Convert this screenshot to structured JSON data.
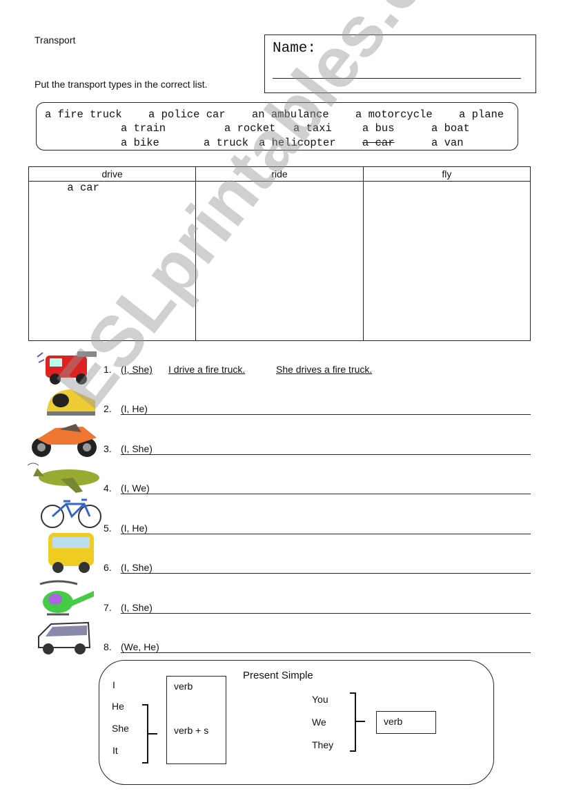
{
  "header": {
    "title": "Transport",
    "instruction": "Put the transport types in the correct list.",
    "name_label": "Name:"
  },
  "word_bank": {
    "rows": [
      [
        "a fire truck",
        "a police car",
        "an ambulance",
        "a motorcycle",
        "a plane"
      ],
      [
        "a train",
        "a rocket",
        "a taxi",
        "a bus",
        "a boat"
      ],
      [
        "a bike",
        "a truck",
        "a helicopter",
        "a car",
        "a van"
      ]
    ],
    "crossed_out": "a car"
  },
  "sort_table": {
    "columns": [
      "drive",
      "ride",
      "fly"
    ],
    "entries": {
      "drive": "a car",
      "ride": "",
      "fly": ""
    }
  },
  "exercises": [
    {
      "num": "1.",
      "prompt": "(I, She)",
      "answer": "I drive a fire truck.",
      "answer2": "She drives a fire truck.",
      "picture": "fire-truck"
    },
    {
      "num": "2.",
      "prompt": "(I, He)",
      "picture": "train"
    },
    {
      "num": "3.",
      "prompt": "(I, She)",
      "picture": "motorcycle"
    },
    {
      "num": "4.",
      "prompt": "(I, We)",
      "picture": "plane"
    },
    {
      "num": "5.",
      "prompt": "(I, He)",
      "picture": "bike"
    },
    {
      "num": "6.",
      "prompt": "(I, She)",
      "picture": "bus"
    },
    {
      "num": "7.",
      "prompt": "(I, She)",
      "picture": "helicopter"
    },
    {
      "num": "8.",
      "prompt": "(We, He)",
      "picture": "van"
    }
  ],
  "grammar": {
    "title": "Present Simple",
    "left_pronouns": [
      "I",
      "He",
      "She",
      "It"
    ],
    "left_box": [
      "verb",
      "verb + s"
    ],
    "right_pronouns": [
      "You",
      "We",
      "They"
    ],
    "right_box": "verb"
  },
  "watermark": "ESLprintables.com"
}
